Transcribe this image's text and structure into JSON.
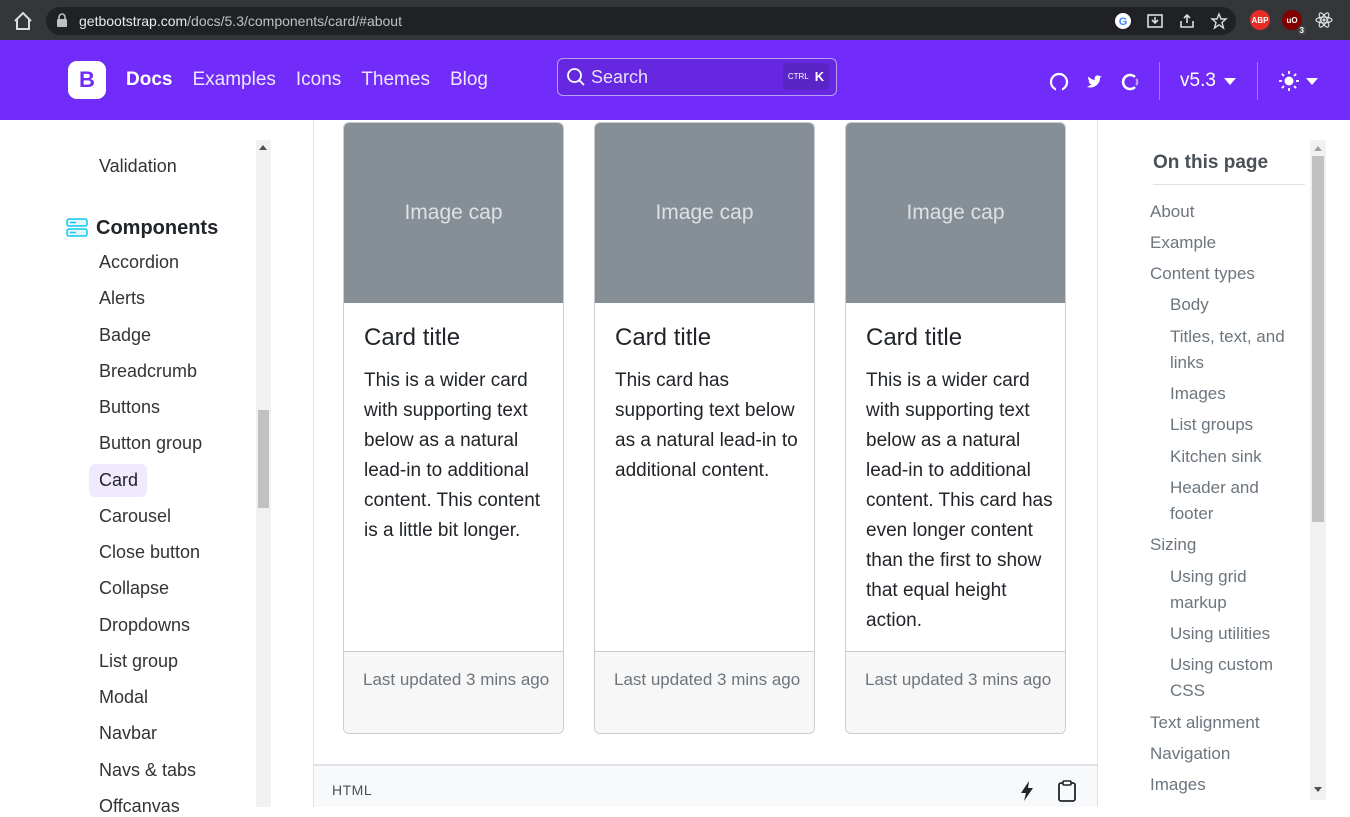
{
  "browser": {
    "url_domain": "getbootstrap.com",
    "url_path": "/docs/5.3/components/card/#about",
    "extensions": [
      {
        "name": "ABP",
        "color": "#e52d27"
      },
      {
        "name": "uBlock",
        "color": "#800000",
        "badge": "3"
      },
      {
        "name": "React",
        "color": "#3a3b3f"
      }
    ]
  },
  "navbar": {
    "brand_letter": "B",
    "links": [
      "Docs",
      "Examples",
      "Icons",
      "Themes",
      "Blog"
    ],
    "search_placeholder": "Search",
    "search_shortcut_ctrl": "CTRL",
    "search_shortcut_key": "K",
    "version": "v5.3",
    "accent_color": "#712cf9"
  },
  "sidebar": {
    "items_above": [
      "Validation"
    ],
    "section_heading": "Components",
    "items": [
      "Accordion",
      "Alerts",
      "Badge",
      "Breadcrumb",
      "Buttons",
      "Button group",
      "Card",
      "Carousel",
      "Close button",
      "Collapse",
      "Dropdowns",
      "List group",
      "Modal",
      "Navbar",
      "Navs & tabs",
      "Offcanvas"
    ],
    "active_item": "Card"
  },
  "cards": [
    {
      "image_label": "Image cap",
      "title": "Card title",
      "text": "This is a wider card with supporting text below as a natural lead-in to additional content. This content is a little bit longer.",
      "footer": "Last updated 3 mins ago"
    },
    {
      "image_label": "Image cap",
      "title": "Card title",
      "text": "This card has supporting text below as a natural lead-in to additional content.",
      "footer": "Last updated 3 mins ago"
    },
    {
      "image_label": "Image cap",
      "title": "Card title",
      "text": "This is a wider card with supporting text below as a natural lead-in to additional content. This card has even longer content than the first to show that equal height action.",
      "footer": "Last updated 3 mins ago"
    }
  ],
  "code_block": {
    "label": "HTML"
  },
  "toc": {
    "title": "On this page",
    "items": [
      {
        "label": "About",
        "level": 1
      },
      {
        "label": "Example",
        "level": 1
      },
      {
        "label": "Content types",
        "level": 1
      },
      {
        "label": "Body",
        "level": 2
      },
      {
        "label": "Titles, text, and links",
        "level": 2
      },
      {
        "label": "Images",
        "level": 2
      },
      {
        "label": "List groups",
        "level": 2
      },
      {
        "label": "Kitchen sink",
        "level": 2
      },
      {
        "label": "Header and footer",
        "level": 2
      },
      {
        "label": "Sizing",
        "level": 1
      },
      {
        "label": "Using grid markup",
        "level": 2
      },
      {
        "label": "Using utilities",
        "level": 2
      },
      {
        "label": "Using custom CSS",
        "level": 2
      },
      {
        "label": "Text alignment",
        "level": 1
      },
      {
        "label": "Navigation",
        "level": 1
      },
      {
        "label": "Images",
        "level": 1
      }
    ]
  }
}
